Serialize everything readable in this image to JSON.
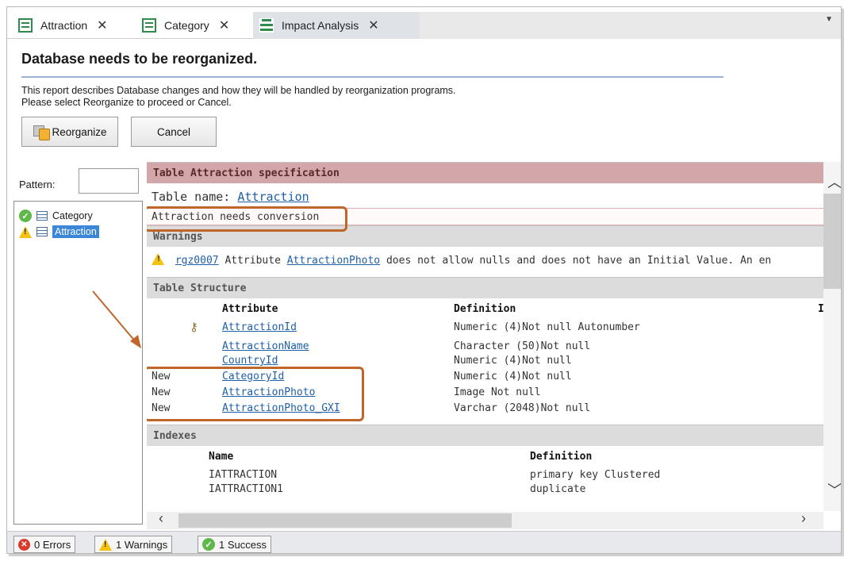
{
  "tabs": [
    {
      "label": "Attraction",
      "close": "✕"
    },
    {
      "label": "Category",
      "close": "✕"
    },
    {
      "label": "Impact Analysis",
      "close": "✕"
    }
  ],
  "header": {
    "title": "Database needs to be reorganized.",
    "description_line1": "This report describes Database changes and how they will be handled by reorganization programs.",
    "description_line2": "Please select Reorganize to proceed or Cancel.",
    "reorganize_label": "Reorganize",
    "cancel_label": "Cancel"
  },
  "left_panel": {
    "pattern_label": "Pattern:",
    "pattern_value": "",
    "items": [
      {
        "label": "Category",
        "status": "success"
      },
      {
        "label": "Attraction",
        "status": "warning",
        "selected": true
      }
    ]
  },
  "spec": {
    "section_title": "Table Attraction specification",
    "table_name_label": "Table name:",
    "table_name_link": "Attraction",
    "conversion_note": "Attraction needs conversion",
    "warnings_title": "Warnings",
    "warning_code": "rgz0007",
    "warning_text_prefix": "Attribute",
    "warning_attribute": "AttractionPhoto",
    "warning_text_suffix": "does not allow nulls and does not have an Initial Value. An en",
    "structure_title": "Table Structure",
    "structure_headers": {
      "attribute": "Attribute",
      "definition": "Definition",
      "extra": "I"
    },
    "structure_rows": [
      {
        "status": "",
        "key": true,
        "attribute": "AttractionId",
        "definition": "Numeric (4)Not null Autonumber"
      },
      {
        "status": "",
        "key": false,
        "attribute": "AttractionName",
        "definition": "Character (50)Not null"
      },
      {
        "status": "",
        "key": false,
        "attribute": "CountryId",
        "definition": "Numeric (4)Not null"
      },
      {
        "status": "New",
        "key": false,
        "attribute": "CategoryId",
        "definition": "Numeric (4)Not null"
      },
      {
        "status": "New",
        "key": false,
        "attribute": "AttractionPhoto",
        "definition": "Image Not null"
      },
      {
        "status": "New",
        "key": false,
        "attribute": "AttractionPhoto_GXI",
        "definition": "Varchar (2048)Not null"
      }
    ],
    "indexes_title": "Indexes",
    "index_headers": {
      "name": "Name",
      "definition": "Definition"
    },
    "index_rows": [
      {
        "name": "IATTRACTION",
        "definition": "primary key Clustered"
      },
      {
        "name": "IATTRACTION1",
        "definition": "duplicate"
      }
    ]
  },
  "statusbar": {
    "errors": "0 Errors",
    "warnings": "1 Warnings",
    "success": "1 Success"
  },
  "colors": {
    "accent_orange": "#c0662a",
    "spec_header": "#d3a7aa",
    "link_blue": "#1f5fa8",
    "selected_blue": "#3b86d6"
  }
}
